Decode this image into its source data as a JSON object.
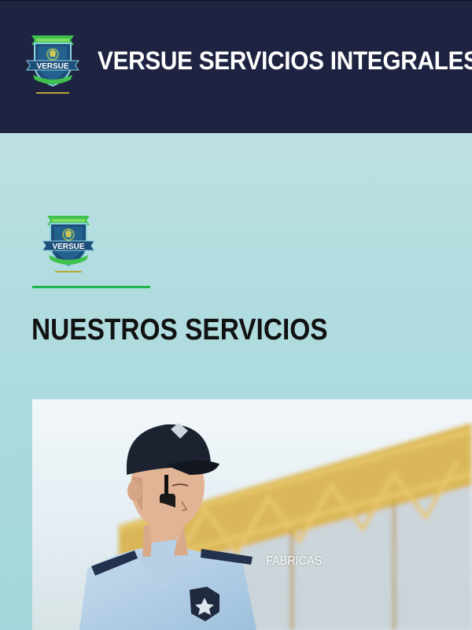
{
  "header": {
    "title": "VERSUE SERVICIOS INTEGRALES",
    "logo": {
      "icon": "versue-shield-logo-icon",
      "text": "VERSUE"
    }
  },
  "section": {
    "logo": {
      "icon": "versue-shield-logo-icon",
      "text": "VERSUE"
    },
    "title": "NUESTROS SERVICIOS"
  },
  "services": [
    {
      "label": "FABRICAS",
      "image": "security-guard-with-radio-photo"
    }
  ],
  "colors": {
    "header_bg": "#1d2340",
    "accent_green": "#22b34a",
    "shield_blue": "#1e4f7a"
  }
}
